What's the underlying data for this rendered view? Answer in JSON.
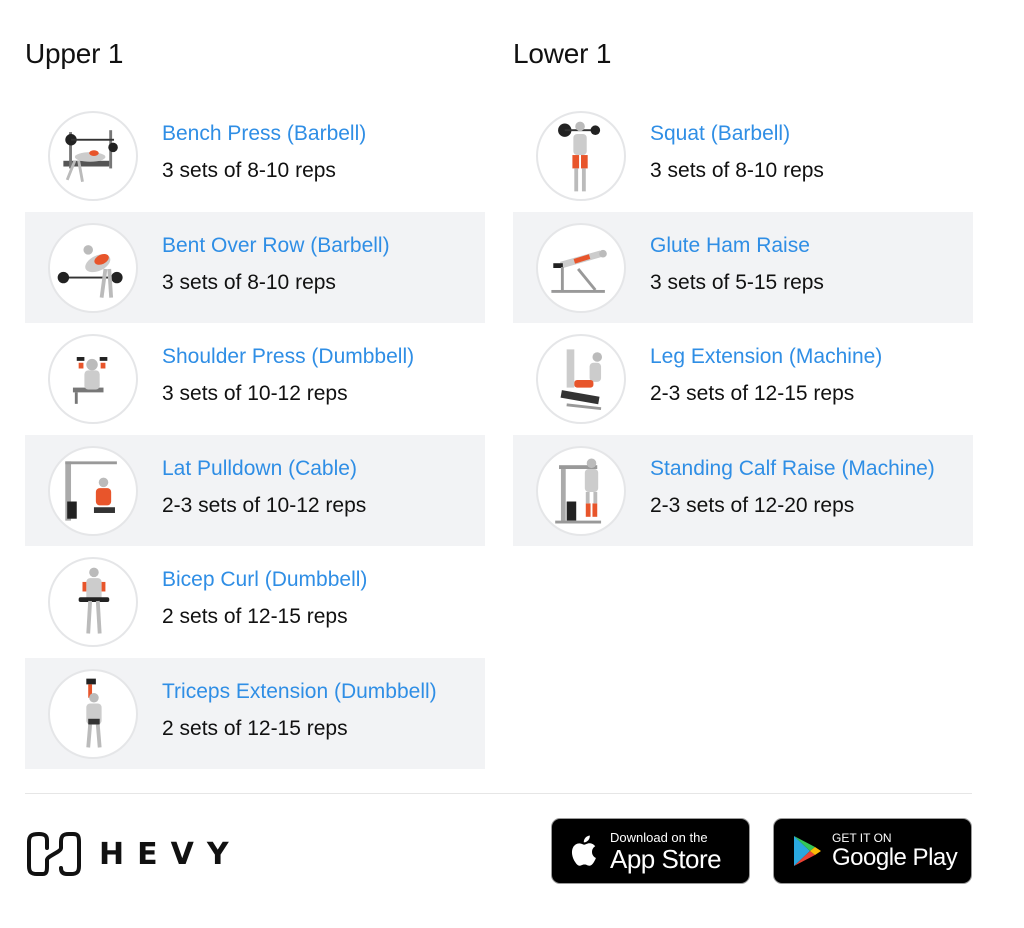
{
  "routines": [
    {
      "title": "Upper 1",
      "exercises": [
        {
          "name": "Bench Press (Barbell)",
          "sets": "3 sets of 8-10 reps",
          "image": "bench-press-illustration"
        },
        {
          "name": "Bent Over Row (Barbell)",
          "sets": "3 sets of 8-10 reps",
          "image": "bent-over-row-illustration"
        },
        {
          "name": "Shoulder Press (Dumbbell)",
          "sets": "3 sets of 10-12 reps",
          "image": "shoulder-press-illustration"
        },
        {
          "name": "Lat Pulldown (Cable)",
          "sets": "2-3 sets of 10-12 reps",
          "image": "lat-pulldown-illustration"
        },
        {
          "name": "Bicep Curl (Dumbbell)",
          "sets": "2 sets of 12-15 reps",
          "image": "bicep-curl-illustration"
        },
        {
          "name": "Triceps Extension (Dumbbell)",
          "sets": "2 sets of 12-15 reps",
          "image": "triceps-extension-illustration"
        }
      ]
    },
    {
      "title": "Lower 1",
      "exercises": [
        {
          "name": "Squat (Barbell)",
          "sets": "3 sets of 8-10 reps",
          "image": "squat-illustration"
        },
        {
          "name": "Glute Ham Raise",
          "sets": "3 sets of 5-15 reps",
          "image": "glute-ham-raise-illustration"
        },
        {
          "name": "Leg Extension (Machine)",
          "sets": "2-3 sets of 12-15 reps",
          "image": "leg-extension-illustration"
        },
        {
          "name": "Standing Calf Raise (Machine)",
          "sets": "2-3 sets of 12-20 reps",
          "image": "standing-calf-raise-illustration"
        }
      ]
    }
  ],
  "footer": {
    "brand": "HEVY",
    "app_store": {
      "small": "Download on the",
      "big": "App Store"
    },
    "google_play": {
      "small": "GET IT ON",
      "big": "Google Play"
    }
  },
  "colors": {
    "link": "#2f8ee5",
    "row_alt": "#f2f3f5",
    "muscle_highlight": "#e8552b"
  }
}
